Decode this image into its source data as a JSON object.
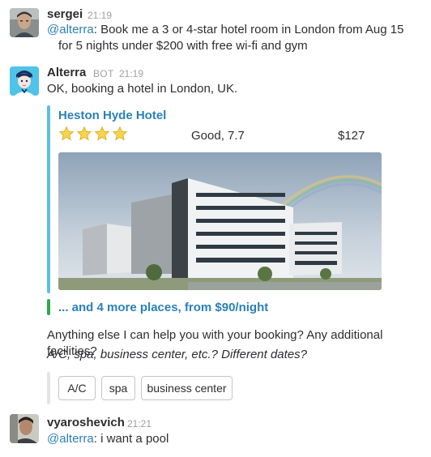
{
  "messages": [
    {
      "author": "sergei",
      "time": "21:19",
      "mention": "@alterra",
      "text_line1": ": Book me a 3 or 4-star hotel room in London from Aug 15",
      "text_line2": "for 5 nights  under $200 with free wi-fi and gym"
    },
    {
      "author": "Alterra",
      "bot_tag": "BOT",
      "time": "21:19",
      "text": "OK, booking a hotel in London, UK.",
      "attachment": {
        "hotel_name": "Heston Hyde Hotel",
        "stars": 4,
        "rating": "Good, 7.7",
        "price": "$127",
        "accent_color": "#5bc0de"
      },
      "more_link": "... and 4 more places, from $90/night",
      "more_accent_color": "#2fa84f",
      "followup_line1": "Anything else I can help you with your booking? Any additional facilities?",
      "followup_line2": "A/C, spa, business center, etc.? Different dates?",
      "buttons": [
        "A/C",
        "spa",
        "business center"
      ]
    },
    {
      "author": "vyaroshevich",
      "time": "21:21",
      "mention": "@alterra",
      "text": ": i want a pool"
    }
  ]
}
